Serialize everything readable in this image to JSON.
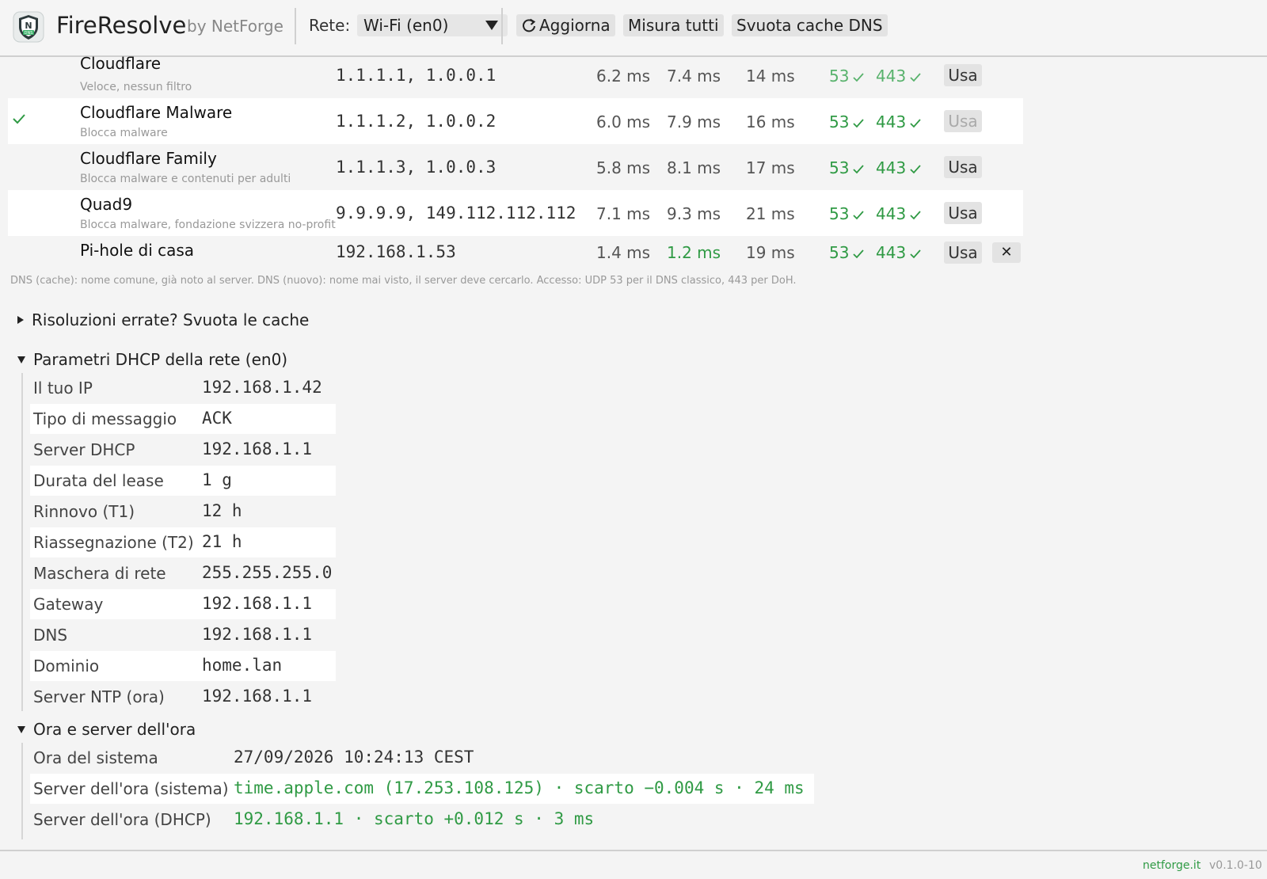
{
  "header": {
    "app_name": "FireResolve",
    "by_label": "by NetForge",
    "network_label": "Rete:",
    "network_value": "Wi-Fi (en0)",
    "refresh_label": "Aggiorna",
    "measure_all_label": "Misura tutti",
    "flush_dns_label": "Svuota cache DNS",
    "logo_badge": "DNS"
  },
  "resolvers": [
    {
      "name": "Cloudflare",
      "desc": "Veloce, nessun filtro",
      "ips": "1.1.1.1, 1.0.0.1",
      "dns_cached": "6.2 ms",
      "dns_new": "7.4 ms",
      "access": "14 ms",
      "port_53": "53",
      "port_443": "443",
      "use_label": "Usa",
      "active": false
    },
    {
      "name": "Cloudflare Malware",
      "desc": "Blocca malware",
      "ips": "1.1.1.2, 1.0.0.2",
      "dns_cached": "6.0 ms",
      "dns_new": "7.9 ms",
      "access": "16 ms",
      "port_53": "53",
      "port_443": "443",
      "use_label": "Usa",
      "active": true
    },
    {
      "name": "Cloudflare Family",
      "desc": "Blocca malware e contenuti per adulti",
      "ips": "1.1.1.3, 1.0.0.3",
      "dns_cached": "5.8 ms",
      "dns_new": "8.1 ms",
      "access": "17 ms",
      "port_53": "53",
      "port_443": "443",
      "use_label": "Usa",
      "active": false
    },
    {
      "name": "Quad9",
      "desc": "Blocca malware, fondazione svizzera no-profit",
      "ips": "9.9.9.9, 149.112.112.112",
      "dns_cached": "7.1 ms",
      "dns_new": "9.3 ms",
      "access": "21 ms",
      "port_53": "53",
      "port_443": "443",
      "use_label": "Usa",
      "active": false
    },
    {
      "name": "Pi-hole di casa",
      "desc": "",
      "ips": "192.168.1.53",
      "dns_cached": "1.4 ms",
      "dns_new": "1.2 ms",
      "access": "19 ms",
      "port_53": "53",
      "port_443": "443",
      "use_label": "Usa",
      "active": false,
      "remove_label": "✕"
    }
  ],
  "legend_note": "DNS (cache): nome comune, già noto al server. DNS (nuovo): nome mai visto, il server deve cercarlo. Accesso: UDP 53 per il DNS classico, 443 per DoH.",
  "cache_section": {
    "title": "Risoluzioni errate? Svuota le cache"
  },
  "dhcp_section": {
    "title": "Parametri DHCP della rete (en0)",
    "rows": [
      {
        "key": "Il tuo IP",
        "value": "192.168.1.42"
      },
      {
        "key": "Tipo di messaggio",
        "value": "ACK"
      },
      {
        "key": "Server DHCP",
        "value": "192.168.1.1"
      },
      {
        "key": "Durata del lease",
        "value": "1 g"
      },
      {
        "key": "Rinnovo (T1)",
        "value": "12 h"
      },
      {
        "key": "Riassegnazione (T2)",
        "value": "21 h"
      },
      {
        "key": "Maschera di rete",
        "value": "255.255.255.0"
      },
      {
        "key": "Gateway",
        "value": "192.168.1.1"
      },
      {
        "key": "DNS",
        "value": "192.168.1.1"
      },
      {
        "key": "Dominio",
        "value": "home.lan"
      },
      {
        "key": "Server NTP (ora)",
        "value": "192.168.1.1"
      }
    ]
  },
  "time_section": {
    "title": "Ora e server dell'ora",
    "rows": [
      {
        "key": "Ora del sistema",
        "value": "27/09/2026 10:24:13 CEST"
      },
      {
        "key": "Server dell'ora (sistema)",
        "value": "time.apple.com (17.253.108.125) · scarto −0.004 s · 24 ms"
      },
      {
        "key": "Server dell'ora (DHCP)",
        "value": "192.168.1.1 · scarto +0.012 s · 3 ms"
      }
    ]
  },
  "footer": {
    "link": "netforge.it",
    "version": "v0.1.0-10"
  },
  "colors": {
    "accent_green": "#2f9a44",
    "muted": "#999999",
    "button_bg": "#e3e3e3"
  }
}
